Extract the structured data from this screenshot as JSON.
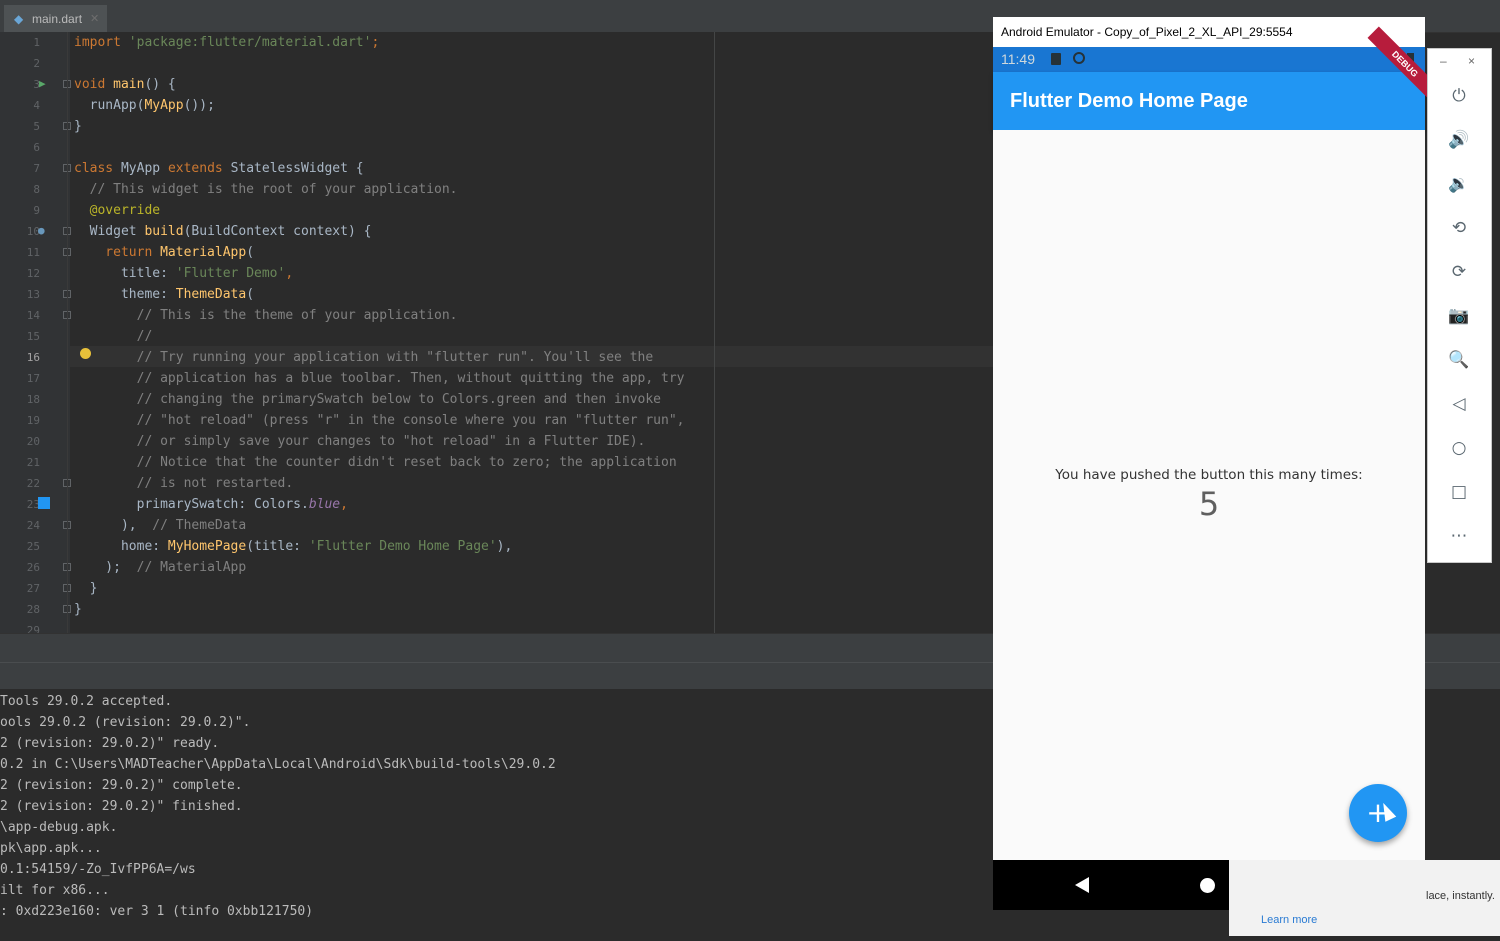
{
  "ide": {
    "tab": {
      "label": "main.dart",
      "icon": "dart-file-icon"
    },
    "line_numbers": [
      "1",
      "2",
      "3",
      "4",
      "5",
      "6",
      "7",
      "8",
      "9",
      "10",
      "11",
      "12",
      "13",
      "14",
      "15",
      "16",
      "17",
      "18",
      "19",
      "20",
      "21",
      "22",
      "23",
      "24",
      "25",
      "26",
      "27",
      "28",
      "29"
    ],
    "current_line": "16",
    "code": [
      [
        [
          "kw",
          "import "
        ],
        [
          "str",
          "'package:flutter/material.dart'"
        ],
        [
          "kw",
          ";"
        ]
      ],
      [],
      [
        [
          "kw",
          "void "
        ],
        [
          "fn",
          "main"
        ],
        [
          "",
          "() {"
        ]
      ],
      [
        [
          "",
          "  runApp("
        ],
        [
          "fn",
          "MyApp"
        ],
        [
          "",
          "());"
        ]
      ],
      [
        [
          "",
          "}"
        ]
      ],
      [],
      [
        [
          "kw",
          "class "
        ],
        [
          "",
          "MyApp "
        ],
        [
          "kw",
          "extends "
        ],
        [
          "",
          "StatelessWidget {"
        ]
      ],
      [
        [
          "cm",
          "  // This widget is the root of your application."
        ]
      ],
      [
        [
          "an",
          "  @override"
        ]
      ],
      [
        [
          "",
          "  Widget "
        ],
        [
          "fn",
          "build"
        ],
        [
          "",
          "(BuildContext context) {"
        ]
      ],
      [
        [
          "kw",
          "    return "
        ],
        [
          "fn",
          "MaterialApp"
        ],
        [
          "",
          "("
        ]
      ],
      [
        [
          "",
          "      title: "
        ],
        [
          "str",
          "'Flutter Demo'"
        ],
        [
          "kw",
          ","
        ]
      ],
      [
        [
          "",
          "      theme: "
        ],
        [
          "fn",
          "ThemeData"
        ],
        [
          "",
          "("
        ]
      ],
      [
        [
          "cm",
          "        // This is the theme of your application."
        ]
      ],
      [
        [
          "cm",
          "        //"
        ]
      ],
      [
        [
          "cm",
          "        // Try running your application with \"flutter run\". You'll see the"
        ]
      ],
      [
        [
          "cm",
          "        // application has a blue toolbar. Then, without quitting the app, try"
        ]
      ],
      [
        [
          "cm",
          "        // changing the primarySwatch below to Colors.green and then invoke"
        ]
      ],
      [
        [
          "cm",
          "        // \"hot reload\" (press \"r\" in the console where you ran \"flutter run\","
        ]
      ],
      [
        [
          "cm",
          "        // or simply save your changes to \"hot reload\" in a Flutter IDE)."
        ]
      ],
      [
        [
          "cm",
          "        // Notice that the counter didn't reset back to zero; the application"
        ]
      ],
      [
        [
          "cm",
          "        // is not restarted."
        ]
      ],
      [
        [
          "",
          "        primarySwatch: Colors."
        ],
        [
          "it",
          "blue"
        ],
        [
          "kw",
          ","
        ]
      ],
      [
        [
          "",
          "      ),  "
        ],
        [
          "cm",
          "// ThemeData"
        ]
      ],
      [
        [
          "",
          "      home: "
        ],
        [
          "fn",
          "MyHomePage"
        ],
        [
          "",
          "(title: "
        ],
        [
          "str",
          "'Flutter Demo Home Page'"
        ],
        [
          "",
          "),"
        ]
      ],
      [
        [
          "",
          "    );  "
        ],
        [
          "cm",
          "// MaterialApp"
        ]
      ],
      [
        [
          "",
          "  }"
        ]
      ],
      [
        [
          "",
          "}"
        ]
      ],
      []
    ],
    "console": [
      "Tools 29.0.2 accepted.",
      "ools 29.0.2 (revision: 29.0.2)\".",
      "2 (revision: 29.0.2)\" ready.",
      "0.2 in C:\\Users\\MADTeacher\\AppData\\Local\\Android\\Sdk\\build-tools\\29.0.2",
      "2 (revision: 29.0.2)\" complete.",
      "2 (revision: 29.0.2)\" finished.",
      "\\app-debug.apk.",
      "pk\\app.apk...",
      "0.1:54159/-Zo_IvfPP6A=/ws",
      "ilt for x86...",
      ": 0xd223e160: ver 3 1 (tinfo 0xbb121750)"
    ]
  },
  "emulator": {
    "window_title": "Android Emulator - Copy_of_Pixel_2_XL_API_29:5554",
    "status_time": "11:49",
    "debug_banner": "DEBUG",
    "appbar_title": "Flutter Demo Home Page",
    "counter_label": "You have pushed the button this many times:",
    "counter_value": "5",
    "fab_label": "+",
    "accent_color": "#2196f3",
    "window_controls": {
      "minimize": "–",
      "close": "×"
    },
    "toolbar_icons": [
      "power-icon",
      "volume-up-icon",
      "volume-down-icon",
      "rotate-left-icon",
      "rotate-right-icon",
      "camera-icon",
      "zoom-icon",
      "back-icon",
      "home-icon",
      "overview-icon",
      "more-icon"
    ],
    "toolbar_glyphs": [
      "⏻",
      "🔊",
      "🔉",
      "⟲",
      "⟳",
      "📷",
      "🔍",
      "◁",
      "○",
      "□",
      "⋯"
    ]
  },
  "notification": {
    "text": "lace, instantly.",
    "link": "Learn more"
  }
}
